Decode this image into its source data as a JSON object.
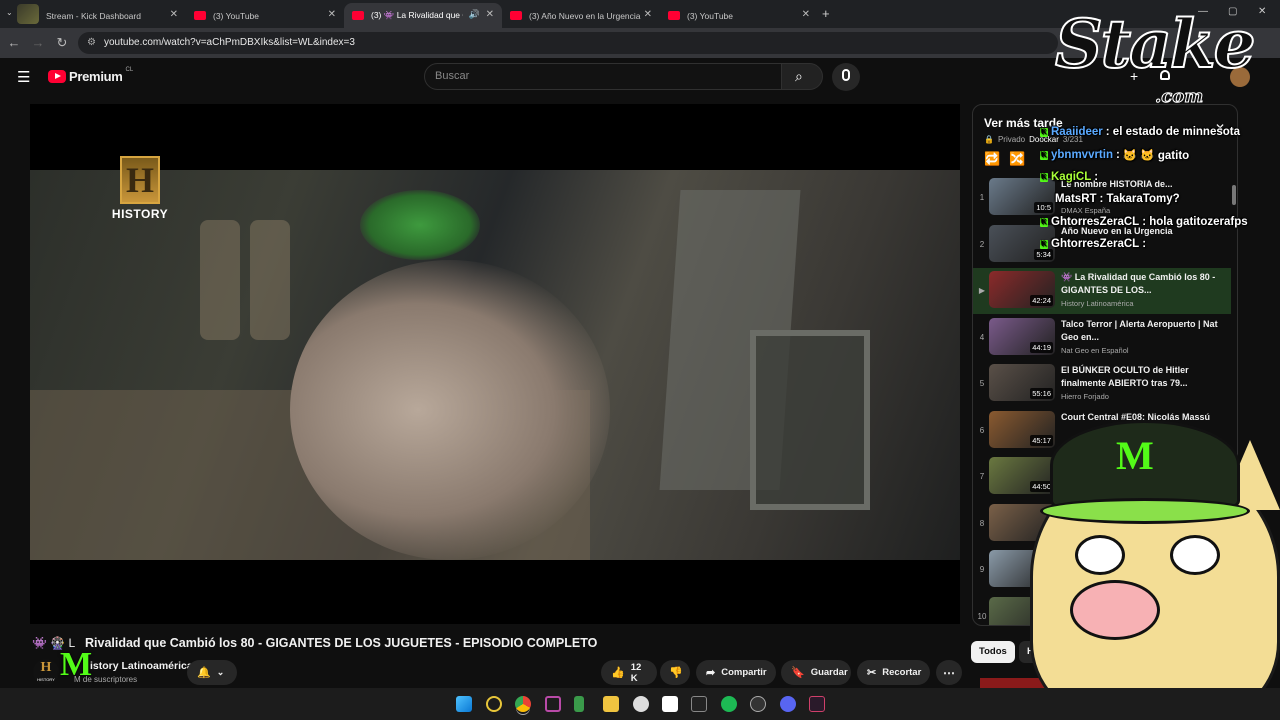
{
  "browser": {
    "tabs": [
      {
        "title": "Stream - Kick Dashboard",
        "active": false
      },
      {
        "title": "(3) YouTube",
        "active": false
      },
      {
        "title": "(3) 👾 La Rivalidad que C",
        "active": true
      },
      {
        "title": "(3) Año Nuevo en la Urgencia",
        "active": false
      },
      {
        "title": "(3) YouTube",
        "active": false
      }
    ],
    "url": "youtube.com/watch?v=aChPmDBXIks&list=WL&index=3"
  },
  "youtube": {
    "logo_text": "Premium",
    "region": "CL",
    "search_placeholder": "Buscar"
  },
  "video": {
    "overlay_logo": "HISTORY",
    "title": "👾 La Rivalidad que Cambió los 80 - GIGANTES DE LOS JUGUETES - EPISODIO COMPLETO",
    "title_visible": "Rivalidad que Cambió los 80 - GIGANTES DE LOS JUGUETES - EPISODIO COMPLETO",
    "channel_name": "History Latinoamérica",
    "channel_visible": "istory Latinoamérica",
    "subscribers": "suscriptores",
    "subscribers_visible": "M de suscriptores",
    "channel_avatar_text": "H",
    "channel_avatar_sub": "HISTORY",
    "likes": "12 K",
    "share": "Compartir",
    "save": "Guardar",
    "clip": "Recortar"
  },
  "playlist": {
    "title": "Ver más tarde",
    "privacy": "Privado",
    "owner": "Doockar",
    "count": "3/231",
    "items": [
      {
        "index": "1",
        "title": "Le nombre HISTORIA de...",
        "channel": "DMAX España",
        "duration": "10:5",
        "color": "#6a7a8a"
      },
      {
        "index": "2",
        "title": "Año Nuevo en la Urgencia",
        "channel": "",
        "duration": "5:34",
        "color": "#4a5058"
      },
      {
        "index": "▶",
        "title": "👾 La Rivalidad que Cambió los 80 - GIGANTES DE LOS...",
        "channel": "History Latinoamérica",
        "duration": "42:24",
        "color": "#8b2a2a"
      },
      {
        "index": "4",
        "title": "Talco Terror | Alerta Aeropuerto | Nat Geo en...",
        "channel": "Nat Geo en Español",
        "duration": "44:19",
        "color": "#7a5a8a"
      },
      {
        "index": "5",
        "title": "El BÚNKER OCULTO de Hitler finalmente ABIERTO tras 79...",
        "channel": "Hierro Forjado",
        "duration": "55:16",
        "color": "#5a5048"
      },
      {
        "index": "6",
        "title": "Court Central #E08: Nicolás Massú",
        "channel": "",
        "duration": "45:17",
        "color": "#8a5a30"
      },
      {
        "index": "7",
        "title": "",
        "channel": "",
        "duration": "44:50",
        "color": "#6a7840"
      },
      {
        "index": "8",
        "title": "",
        "channel": "",
        "duration": "",
        "color": "#7a6048"
      },
      {
        "index": "9",
        "title": "",
        "channel": "",
        "duration": "",
        "color": "#8a9aa8"
      },
      {
        "index": "10",
        "title": "",
        "channel": "",
        "duration": "51",
        "color": "#5a6a48"
      }
    ],
    "chips": [
      "Todos",
      "H"
    ]
  },
  "stream_overlay": {
    "brand": "Stake",
    "brand_suffix": ".com",
    "chat": [
      {
        "user": "Raaiideer",
        "message": ": el estado de minnesota",
        "color": "blue"
      },
      {
        "user": "ybnmvvrtin",
        "message": ":",
        "extra": "gatito",
        "color": "blue"
      },
      {
        "user": "KagiCL",
        "message": ":",
        "color": "green"
      },
      {
        "user": "MatsRT",
        "message": ": TakaraTomy?",
        "color": "white"
      },
      {
        "user": "GhtorresZeraCL",
        "message": ": hola gatitozerafps",
        "color": "white"
      },
      {
        "user": "GhtorresZeraCL",
        "message": ":",
        "color": "white"
      }
    ]
  },
  "colors": {
    "accent_red": "#ff0033",
    "kick_green": "#53fc18",
    "chrome_bg": "#35363a"
  }
}
